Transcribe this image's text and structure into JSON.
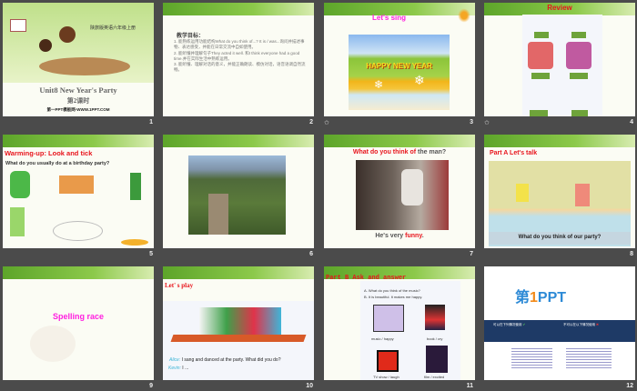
{
  "slides": [
    {
      "num": "1",
      "subtitle_cn": "陕旅版英语六年级上册",
      "title": "Unit8 New Year's Party",
      "lesson": "第2课时",
      "site": "第一PPT模板网-WWW.1PPT.COM"
    },
    {
      "num": "2",
      "heading": "教学目标：",
      "lines": [
        "1. 能熟练运用功能结构What do you think of...? It is / was...询问并描述事物、表达感受，并能在日常交流中自如使用。",
        "2. 能听懂并理解句子They acted it well. 和I think everyone had a good time.并在实际生活中熟练运用。",
        "3. 能听懂、理解对话的意义，并能正确朗读、模仿对话，语音语调自然流畅。"
      ]
    },
    {
      "num": "3",
      "title": "Let's sing",
      "banner": "HAPPY NEW YEAR"
    },
    {
      "num": "4",
      "title": "Review"
    },
    {
      "num": "5",
      "title": "Warming-up:  Look and tick",
      "question": "What do you usually do at a birthday party?"
    },
    {
      "num": "6"
    },
    {
      "num": "7",
      "q_red": "What do you think of",
      "q_rest": " the man?",
      "a_pre": "He's very ",
      "a_red": "funny",
      "a_post": "."
    },
    {
      "num": "8",
      "title": "Part A Let's talk",
      "caption": "What do you think of our party?"
    },
    {
      "num": "9",
      "title": "Spelling race"
    },
    {
      "num": "10",
      "title": "Let' s play",
      "alice": "Alice:",
      "alice_line": "I sang and danced at the party. What did you do?",
      "kevin": "Kevin:",
      "kevin_line": "I ..."
    },
    {
      "num": "11",
      "title": "Part B Ask and answer",
      "qa": [
        "A. What do you think of the music?",
        "B. It is beautiful. It makes me happy."
      ],
      "items": [
        "music / happy",
        "book / cry",
        "TV show / laugh",
        "film / excited"
      ]
    },
    {
      "num": "12",
      "logo_cn": "第",
      "logo_num": "1",
      "logo_en": "PPT",
      "left_head": "可以在下列情况使用",
      "right_head": "不可以在以下情况使用"
    }
  ],
  "colors": {
    "red": "#e8141c",
    "magenta": "#ff20e0",
    "bg": "#4b4b4b"
  }
}
